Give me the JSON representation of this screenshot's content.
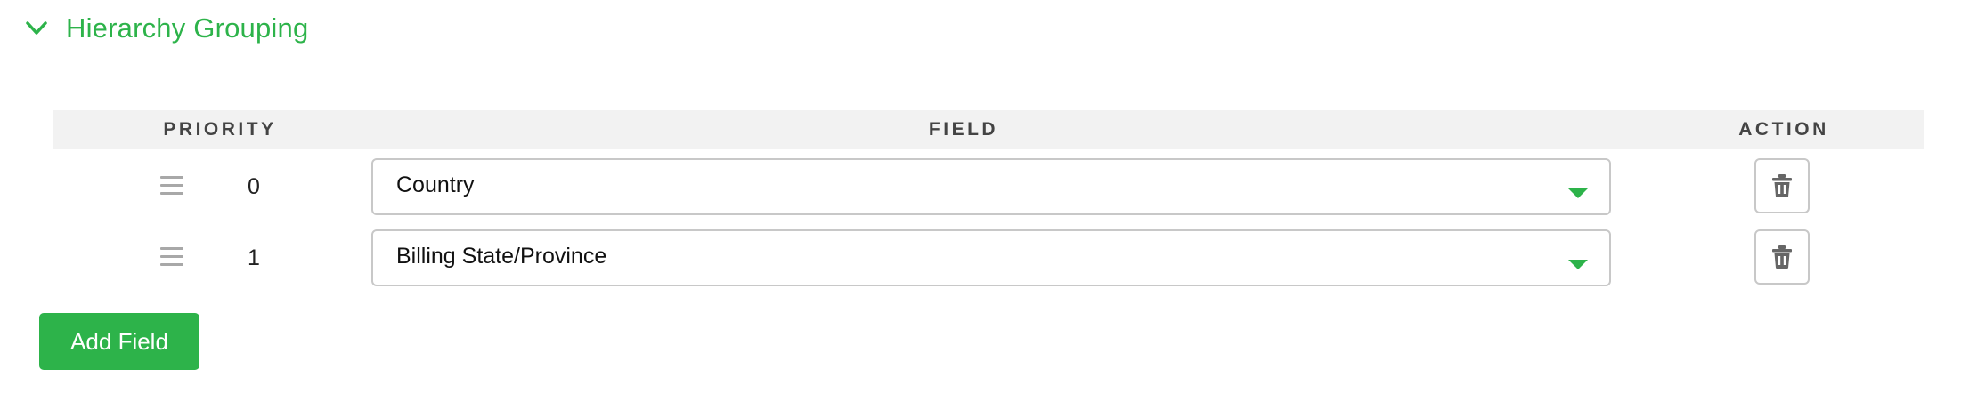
{
  "section": {
    "title": "Hierarchy Grouping",
    "expanded": true
  },
  "table": {
    "columns": {
      "priority": "PRIORITY",
      "field": "FIELD",
      "action": "ACTION"
    },
    "rows": [
      {
        "priority": "0",
        "field": "Country"
      },
      {
        "priority": "1",
        "field": "Billing State/Province"
      }
    ]
  },
  "add_button": {
    "label": "Add Field"
  },
  "icons": {
    "collapse": "chevron-down-icon",
    "drag": "drag-handle-icon",
    "dropdown": "caret-down-icon",
    "delete": "trash-icon"
  },
  "colors": {
    "accent": "#2db34a",
    "header_bg": "#f2f2f2",
    "border": "#c8c8c8"
  }
}
